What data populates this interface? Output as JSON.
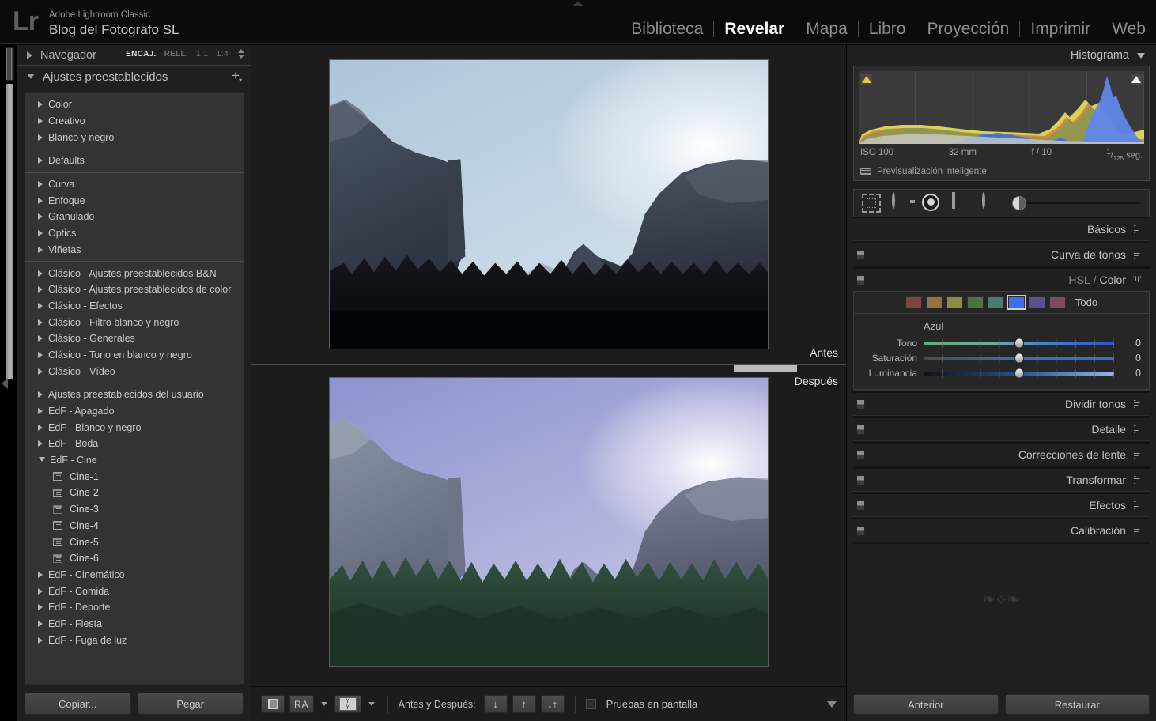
{
  "app": {
    "logo_text": "Lr",
    "product": "Adobe Lightroom Classic",
    "catalog": "Blog del Fotografo SL"
  },
  "modules": [
    {
      "label": "Biblioteca",
      "active": false
    },
    {
      "label": "Revelar",
      "active": true
    },
    {
      "label": "Mapa",
      "active": false
    },
    {
      "label": "Libro",
      "active": false
    },
    {
      "label": "Proyección",
      "active": false
    },
    {
      "label": "Imprimir",
      "active": false
    },
    {
      "label": "Web",
      "active": false
    }
  ],
  "left_panel": {
    "navigator": {
      "title": "Navegador",
      "zoom_levels": [
        {
          "label": "ENCAJ.",
          "active": true
        },
        {
          "label": "RELL.",
          "active": false
        },
        {
          "label": "1:1",
          "active": false
        },
        {
          "label": "1:4",
          "active": false
        }
      ]
    },
    "presets": {
      "title": "Ajustes preestablecidos",
      "add_label": "+",
      "groups": [
        {
          "items": [
            {
              "label": "Color",
              "type": "folder",
              "expanded": false
            },
            {
              "label": "Creativo",
              "type": "folder",
              "expanded": false
            },
            {
              "label": "Blanco y negro",
              "type": "folder",
              "expanded": false
            }
          ]
        },
        {
          "items": [
            {
              "label": "Defaults",
              "type": "folder",
              "expanded": false
            }
          ]
        },
        {
          "items": [
            {
              "label": "Curva",
              "type": "folder",
              "expanded": false
            },
            {
              "label": "Enfoque",
              "type": "folder",
              "expanded": false
            },
            {
              "label": "Granulado",
              "type": "folder",
              "expanded": false
            },
            {
              "label": "Optics",
              "type": "folder",
              "expanded": false
            },
            {
              "label": "Viñetas",
              "type": "folder",
              "expanded": false
            }
          ]
        },
        {
          "items": [
            {
              "label": "Clásico - Ajustes preestablecidos B&N",
              "type": "folder",
              "expanded": false
            },
            {
              "label": "Clásico - Ajustes preestablecidos de color",
              "type": "folder",
              "expanded": false
            },
            {
              "label": "Clásico - Efectos",
              "type": "folder",
              "expanded": false
            },
            {
              "label": "Clásico - Filtro blanco y negro",
              "type": "folder",
              "expanded": false
            },
            {
              "label": "Clásico - Generales",
              "type": "folder",
              "expanded": false
            },
            {
              "label": "Clásico - Tono en blanco y negro",
              "type": "folder",
              "expanded": false
            },
            {
              "label": "Clásico - Vídeo",
              "type": "folder",
              "expanded": false
            }
          ]
        },
        {
          "items": [
            {
              "label": "Ajustes preestablecidos del usuario",
              "type": "folder",
              "expanded": false
            },
            {
              "label": "EdF - Apagado",
              "type": "folder",
              "expanded": false
            },
            {
              "label": "EdF - Blanco y negro",
              "type": "folder",
              "expanded": false
            },
            {
              "label": "EdF - Boda",
              "type": "folder",
              "expanded": false
            },
            {
              "label": "EdF - Cine",
              "type": "folder",
              "expanded": true
            },
            {
              "label": "Cine-1",
              "type": "preset"
            },
            {
              "label": "Cine-2",
              "type": "preset"
            },
            {
              "label": "Cine-3",
              "type": "preset"
            },
            {
              "label": "Cine-4",
              "type": "preset"
            },
            {
              "label": "Cine-5",
              "type": "preset"
            },
            {
              "label": "Cine-6",
              "type": "preset"
            },
            {
              "label": "EdF - Cinemático",
              "type": "folder",
              "expanded": false
            },
            {
              "label": "EdF - Comida",
              "type": "folder",
              "expanded": false
            },
            {
              "label": "EdF - Deporte",
              "type": "folder",
              "expanded": false
            },
            {
              "label": "EdF - Fiesta",
              "type": "folder",
              "expanded": false
            },
            {
              "label": "EdF - Fuga de luz",
              "type": "folder",
              "expanded": false
            }
          ]
        }
      ]
    },
    "buttons": {
      "copy": "Copiar...",
      "paste": "Pegar"
    }
  },
  "viewer": {
    "before_label": "Antes",
    "after_label": "Después"
  },
  "toolbar": {
    "view_loupe_icon": "loupe-view-icon",
    "ra_label": "RA",
    "yy_top": "Y",
    "yy_bottom": "Y",
    "before_after_label": "Antes y Después:",
    "copy_settings_buttons": [
      "↓",
      "↑",
      "↔"
    ],
    "softproof_label": "Pruebas en pantalla"
  },
  "right_panel": {
    "histogram": {
      "title": "Histograma",
      "iso": "ISO 100",
      "focal": "32 mm",
      "aperture": "f / 10",
      "shutter_num": "1",
      "shutter_den": "125",
      "shutter_unit": "seg.",
      "smart_preview": "Previsualización inteligente"
    },
    "tools": [
      {
        "name": "crop-tool",
        "label": "Superposición de recorte"
      },
      {
        "name": "spot-removal-tool",
        "label": "Eliminación de manchas"
      },
      {
        "name": "redeye-tool",
        "label": "Corrección de ojos rojos"
      },
      {
        "name": "graduated-filter-tool",
        "label": "Filtro graduado"
      },
      {
        "name": "radial-filter-tool",
        "label": "Filtro radial"
      },
      {
        "name": "adjustment-brush-tool",
        "label": "Pincel de ajuste"
      }
    ],
    "sections": [
      {
        "label": "Básicos",
        "switch": false,
        "expanded": false
      },
      {
        "label": "Curva de tonos",
        "switch": true,
        "expanded": false
      },
      {
        "label": "HSL / Color",
        "label_a": "HSL",
        "label_sep": "/",
        "label_b": "Color",
        "switch": true,
        "expanded": true
      }
    ],
    "hsl": {
      "swatches": [
        {
          "name": "rojo",
          "color": "#7d4444",
          "selected": false
        },
        {
          "name": "naranja",
          "color": "#99713e",
          "selected": false
        },
        {
          "name": "amarillo",
          "color": "#8d8d44",
          "selected": false
        },
        {
          "name": "verde",
          "color": "#4f7243",
          "selected": false
        },
        {
          "name": "aguamarina",
          "color": "#4a7a70",
          "selected": false
        },
        {
          "name": "azul",
          "color": "#3d6ef0",
          "selected": true
        },
        {
          "name": "purpura",
          "color": "#5c4f91",
          "selected": false
        },
        {
          "name": "magenta",
          "color": "#7d4a62",
          "selected": false
        }
      ],
      "all_label": "Todo",
      "channel": "Azul",
      "sliders": [
        {
          "label": "Tono",
          "value": "0"
        },
        {
          "label": "Saturación",
          "value": "0"
        },
        {
          "label": "Luminancia",
          "value": "0"
        }
      ]
    },
    "sections_lower": [
      {
        "label": "Dividir tonos",
        "switch": true
      },
      {
        "label": "Detalle",
        "switch": true
      },
      {
        "label": "Correcciones de lente",
        "switch": true
      },
      {
        "label": "Transformar",
        "switch": true
      },
      {
        "label": "Efectos",
        "switch": true
      },
      {
        "label": "Calibración",
        "switch": true
      }
    ],
    "buttons": {
      "previous": "Anterior",
      "reset": "Restaurar"
    }
  },
  "colors": {
    "panel_bg": "#1f1f1f",
    "canvas_bg": "#1c1c1c",
    "accent_text": "#ffffff",
    "hsl_selected": "#3d6ef0"
  }
}
